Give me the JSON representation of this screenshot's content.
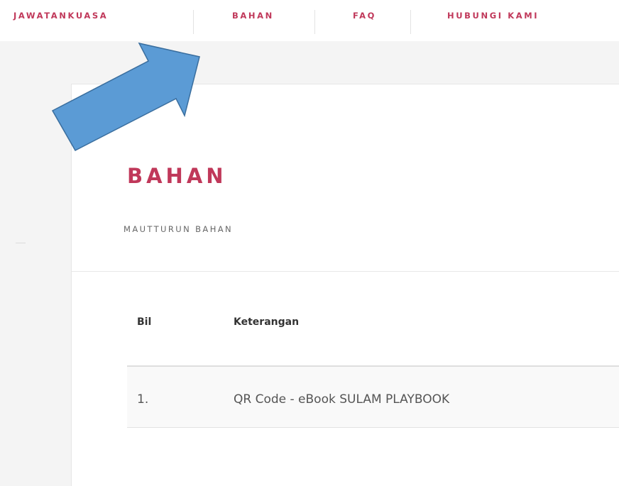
{
  "nav": {
    "items": [
      {
        "label": "JAWATANKUASA"
      },
      {
        "label": "BAHAN"
      },
      {
        "label": "FAQ"
      },
      {
        "label": "HUBUNGI KAMI"
      }
    ]
  },
  "page": {
    "title": "BAHAN",
    "subtitle": "MAUTTURUN BAHAN"
  },
  "table": {
    "headers": [
      "Bil",
      "Keterangan"
    ],
    "rows": [
      {
        "bil": "1.",
        "keterangan": "QR Code - eBook SULAM PLAYBOOK"
      }
    ]
  },
  "colors": {
    "accent": "#c0385a",
    "annotation_arrow": "#5b9bd5",
    "annotation_arrow_border": "#3a6e9e"
  },
  "icons": {
    "annotation": "blue-arrow-pointing-up-right"
  }
}
